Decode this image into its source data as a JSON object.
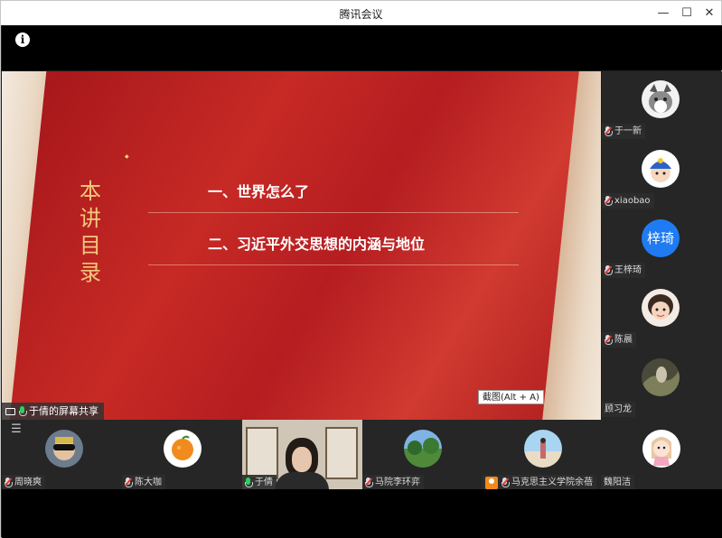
{
  "window": {
    "title": "腾讯会议"
  },
  "slide": {
    "vertical_title": [
      "本",
      "讲",
      "目",
      "录"
    ],
    "items": [
      "一、世界怎么了",
      "二、习近平外交思想的内涵与地位"
    ]
  },
  "screenshot_tip": "截图(Alt + A)",
  "share_label": "于倩的屏幕共享",
  "right_participants": [
    {
      "name": "于一新",
      "muted": true
    },
    {
      "name": "xiaobao",
      "muted": true
    },
    {
      "name": "王梓琦",
      "muted": true,
      "avatar_text": "梓琦"
    },
    {
      "name": "陈晨",
      "muted": true
    },
    {
      "name": "顾习龙",
      "muted": true
    }
  ],
  "bottom_participants": [
    {
      "name": "周晓爽",
      "muted": true
    },
    {
      "name": "陈大咖",
      "muted": true
    },
    {
      "name": "于倩",
      "muted": false,
      "video": true
    },
    {
      "name": "马院李环弈",
      "muted": true
    },
    {
      "name": "马克思主义学院余蓓",
      "muted": true,
      "badge": true
    },
    {
      "name": "魏阳洁",
      "muted": false
    }
  ],
  "colors": {
    "slide_red": "#b9201f",
    "title_gold": "#f3c77b",
    "accent_blue": "#1f7bf2",
    "mic_green": "#2bd15b"
  }
}
